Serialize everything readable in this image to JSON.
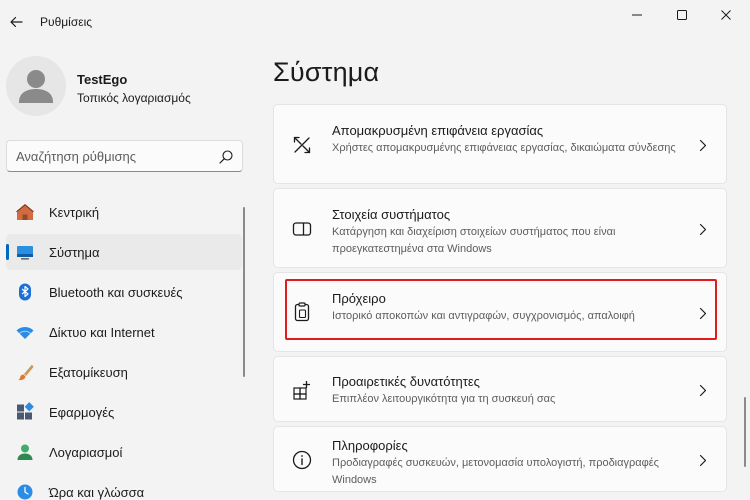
{
  "window": {
    "title": "Ρυθμίσεις",
    "controls": [
      "minimize-icon",
      "maximize-icon",
      "close-icon"
    ]
  },
  "profile": {
    "name": "TestEgo",
    "account_type": "Τοπικός λογαριασμός"
  },
  "search": {
    "placeholder": "Αναζήτηση ρύθμισης",
    "value": ""
  },
  "sidebar": {
    "items": [
      {
        "label": "Κεντρική",
        "icon": "home-icon",
        "active": false
      },
      {
        "label": "Σύστημα",
        "icon": "system-icon",
        "active": true
      },
      {
        "label": "Bluetooth και συσκευές",
        "icon": "bluetooth-icon",
        "active": false
      },
      {
        "label": "Δίκτυο και Internet",
        "icon": "wifi-icon",
        "active": false
      },
      {
        "label": "Εξατομίκευση",
        "icon": "brush-icon",
        "active": false
      },
      {
        "label": "Εφαρμογές",
        "icon": "apps-icon",
        "active": false
      },
      {
        "label": "Λογαριασμοί",
        "icon": "accounts-icon",
        "active": false
      },
      {
        "label": "Ώρα και γλώσσα",
        "icon": "time-language-icon",
        "active": false
      }
    ]
  },
  "main": {
    "title": "Σύστημα",
    "cards": [
      {
        "title": "Απομακρυσμένη επιφάνεια εργασίας",
        "desc": "Χρήστες απομακρυσμένης επιφάνειας εργασίας, δικαιώματα σύνδεσης",
        "icon": "remote-desktop-icon"
      },
      {
        "title": "Στοιχεία συστήματος",
        "desc": "Κατάργηση και διαχείριση στοιχείων συστήματος που είναι προεγκατεστημένα στα Windows",
        "icon": "system-components-icon"
      },
      {
        "title": "Πρόχειρο",
        "desc": "Ιστορικό αποκοπών και αντιγραφών, συγχρονισμός, απαλοιφή",
        "icon": "clipboard-icon",
        "highlighted": true
      },
      {
        "title": "Προαιρετικές δυνατότητες",
        "desc": "Επιπλέον λειτουργικότητα για τη συσκευή σας",
        "icon": "optional-features-icon"
      },
      {
        "title": "Πληροφορίες",
        "desc": "Προδιαγραφές συσκευών, μετονομασία υπολογιστή, προδιαγραφές Windows",
        "icon": "info-icon"
      }
    ]
  },
  "colors": {
    "accent": "#0067c0",
    "highlight": "#e21b1b",
    "background": "#f3f3f3",
    "card": "#fbfbfb"
  }
}
